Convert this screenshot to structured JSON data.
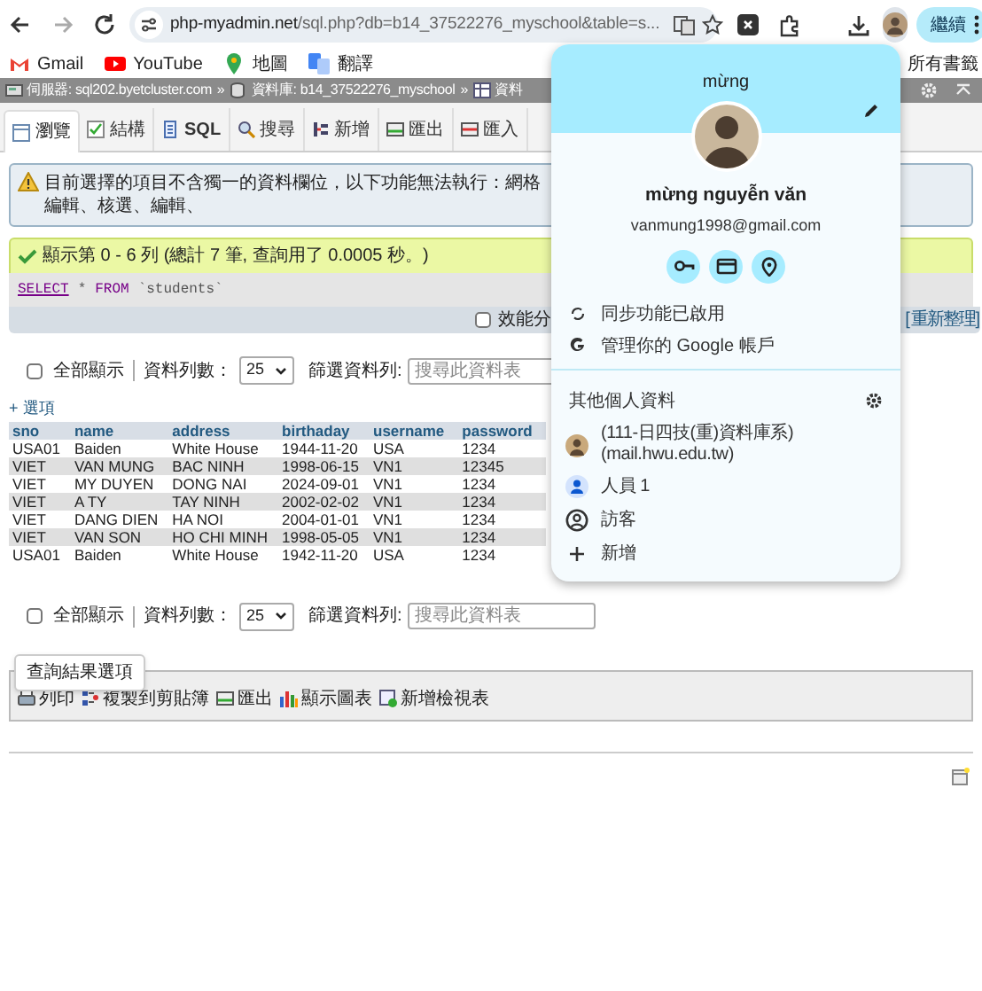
{
  "browser": {
    "url_host": "php-myadmin.net",
    "url_path": "/sql.php?db=b14_37522276_myschool&table=s...",
    "profile_button": "繼續"
  },
  "bookmarks": [
    {
      "label": "Gmail",
      "kind": "gmail"
    },
    {
      "label": "YouTube",
      "kind": "youtube"
    },
    {
      "label": "地圖",
      "kind": "maps"
    },
    {
      "label": "翻譯",
      "kind": "translate"
    }
  ],
  "all_bookmarks": "所有書籤",
  "breadcrumb": [
    {
      "label": "伺服器: sql202.byetcluster.com",
      "kind": "server"
    },
    {
      "label": "資料庫: b14_37522276_myschool",
      "kind": "database",
      "separator": "»"
    },
    {
      "label": "資料",
      "kind": "table",
      "separator": "»"
    }
  ],
  "tabs": [
    {
      "label": "瀏覽",
      "kind": "browse",
      "selected": true
    },
    {
      "label": "結構",
      "kind": "structure",
      "selected": false
    },
    {
      "label": "SQL",
      "kind": "sql",
      "selected": false
    },
    {
      "label": "搜尋",
      "kind": "search",
      "selected": false
    },
    {
      "label": "新增",
      "kind": "insert",
      "selected": false
    },
    {
      "label": "匯出",
      "kind": "export",
      "selected": false
    },
    {
      "label": "匯入",
      "kind": "import",
      "selected": false
    }
  ],
  "notice": "目前選擇的項目不含獨一的資料欄位，以下功能無法執行：網格編輯、核選、編輯、",
  "success": "顯示第 0 - 6 列 (總計 7 筆, 查詢用了 0.0005 秒。)",
  "sql_query": [
    {
      "text": "SELECT",
      "kind": "keyword_link"
    },
    {
      "text": "*",
      "kind": "operator"
    },
    {
      "text": "FROM",
      "kind": "keyword"
    },
    {
      "text": "`students`",
      "kind": "identifier"
    }
  ],
  "profiling": {
    "label": "效能分",
    "checked": false
  },
  "refresh": "[ 重新整理]",
  "navigation": [
    {
      "show_all": {
        "label": "全部顯示",
        "checked": false
      },
      "rows_label": "資料列數：",
      "rows_value": "25",
      "filter_label": "篩選資料列:",
      "filter_placeholder": "搜尋此資料表"
    },
    {
      "show_all": {
        "label": "全部顯示",
        "checked": false
      },
      "rows_label": "資料列數：",
      "rows_value": "25",
      "filter_label": "篩選資料列:",
      "filter_placeholder": "搜尋此資料表"
    }
  ],
  "options_link": "+ 選項",
  "table": {
    "columns": [
      "sno",
      "name",
      "address",
      "birthaday",
      "username",
      "password"
    ],
    "rows": [
      [
        "USA01",
        "Baiden",
        "White House",
        "1944-11-20",
        "USA",
        "1234"
      ],
      [
        "VIET",
        "VAN MUNG",
        "BAC NINH",
        "1998-06-15",
        "VN1",
        "12345"
      ],
      [
        "VIET",
        "MY DUYEN",
        "DONG NAI",
        "2024-09-01",
        "VN1",
        "1234"
      ],
      [
        "VIET",
        "A TY",
        "TAY NINH",
        "2002-02-02",
        "VN1",
        "1234"
      ],
      [
        "VIET",
        "DANG DIEN",
        "HA NOI",
        "2004-01-01",
        "VN1",
        "1234"
      ],
      [
        "VIET",
        "VAN SON",
        "HO CHI MINH",
        "1998-05-05",
        "VN1",
        "1234"
      ],
      [
        "USA01",
        "Baiden",
        "White House",
        "1942-11-20",
        "USA",
        "1234"
      ]
    ]
  },
  "query_results_operations": {
    "legend": "查詢結果選項",
    "actions": [
      {
        "label": "列印",
        "kind": "print"
      },
      {
        "label": "複製到剪貼簿",
        "kind": "copy"
      },
      {
        "label": "匯出",
        "kind": "export"
      },
      {
        "label": "顯示圖表",
        "kind": "chart"
      },
      {
        "label": "新增檢視表",
        "kind": "view"
      }
    ]
  },
  "profile_menu": {
    "header_name": "mừng",
    "name": "mừng nguyễn văn",
    "email": "vanmung1998@gmail.com",
    "quick_actions": [
      {
        "kind": "key"
      },
      {
        "kind": "card"
      },
      {
        "kind": "location"
      }
    ],
    "items": [
      {
        "label": "同步功能已啟用",
        "kind": "sync"
      },
      {
        "label": "管理你的 Google 帳戶",
        "kind": "google"
      }
    ],
    "other_profiles_title": "其他個人資料",
    "profiles": [
      {
        "label": "(111-日四技(重)資料庫系) (mail.hwu.edu.tw)",
        "kind": "photo"
      },
      {
        "label": "人員 1",
        "kind": "person"
      },
      {
        "label": "訪客",
        "kind": "guest"
      },
      {
        "label": "新增",
        "kind": "add"
      }
    ]
  }
}
